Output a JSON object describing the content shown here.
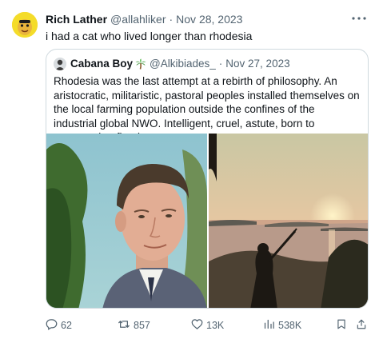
{
  "tweet": {
    "author_name": "Rich Lather",
    "author_handle": "@allahliker",
    "separator": "·",
    "date": "Nov 28, 2023",
    "text": "i had a cat who lived longer than rhodesia"
  },
  "quote": {
    "author_name": "Cabana Boy",
    "author_handle": "@Alkibiades_",
    "separator": "·",
    "date": "Nov 27, 2023",
    "text": "Rhodesia was the last attempt at a rebirth of philosophy.  An aristocratic, militaristic, pastoral peoples installed themselves on the local farming population outside the confines of the industrial global NWO.  Intelligent, cruel, astute, born to command, refined, courageous."
  },
  "actions": {
    "replies": "62",
    "reposts": "857",
    "likes": "13K",
    "views": "538K"
  },
  "icons": {
    "more": "more-dots-icon",
    "reply": "reply-icon",
    "repost": "repost-icon",
    "like": "heart-icon",
    "views": "views-chart-icon",
    "bookmark": "bookmark-icon",
    "share": "share-icon",
    "palm": "palm-tree-emoji"
  },
  "colors": {
    "text_primary": "#0f1419",
    "text_secondary": "#536471",
    "border": "#cfd9de"
  }
}
